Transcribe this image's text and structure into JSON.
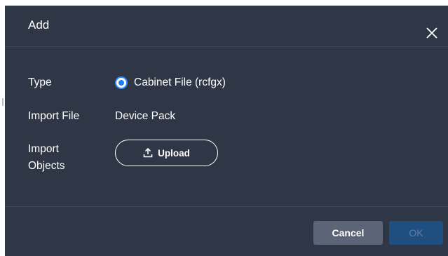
{
  "dialog": {
    "title": "Add",
    "close_icon": "close-icon"
  },
  "form": {
    "type_label": "Type",
    "type_option": "Cabinet File (rcfgx)",
    "type_selected": true,
    "import_file_label": "Import File",
    "import_file_value": "Device Pack",
    "import_objects_label": "Import Objects",
    "upload_label": "Upload",
    "upload_icon": "upload-icon"
  },
  "footer": {
    "cancel_label": "Cancel",
    "ok_label": "OK"
  },
  "colors": {
    "dialog_bg": "#2f3747",
    "accent": "#2f8cff",
    "cancel_bg": "#5c6577",
    "ok_disabled_bg": "#1f4f80"
  }
}
